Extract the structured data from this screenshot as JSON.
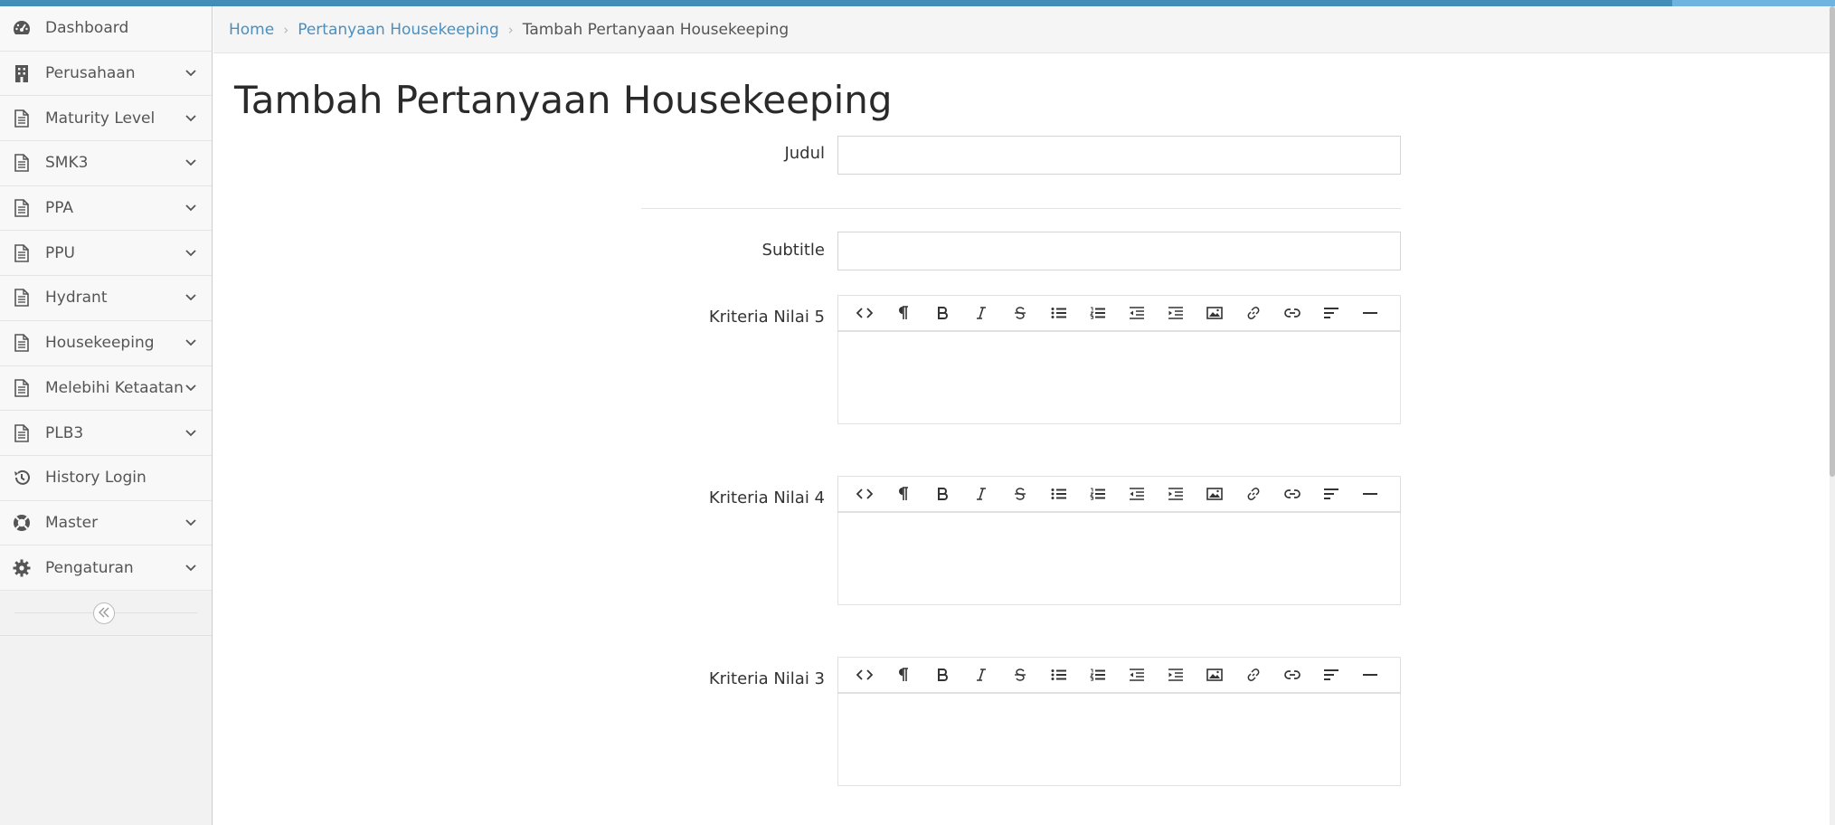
{
  "colors": {
    "topbar": "#438eb9",
    "link": "#4c8fbd",
    "sidebar_bg": "#f2f2f2"
  },
  "sidebar": {
    "items": [
      {
        "label": "Dashboard",
        "icon": "dashboard-icon",
        "has_children": false
      },
      {
        "label": "Perusahaan",
        "icon": "building-icon",
        "has_children": true
      },
      {
        "label": "Maturity Level",
        "icon": "document-icon",
        "has_children": true
      },
      {
        "label": "SMK3",
        "icon": "document-icon",
        "has_children": true
      },
      {
        "label": "PPA",
        "icon": "document-icon",
        "has_children": true
      },
      {
        "label": "PPU",
        "icon": "document-icon",
        "has_children": true
      },
      {
        "label": "Hydrant",
        "icon": "document-icon",
        "has_children": true
      },
      {
        "label": "Housekeeping",
        "icon": "document-icon",
        "has_children": true
      },
      {
        "label": "Melebihi Ketaatan",
        "icon": "document-icon",
        "has_children": true
      },
      {
        "label": "PLB3",
        "icon": "document-icon",
        "has_children": true
      },
      {
        "label": "History Login",
        "icon": "history-icon",
        "has_children": false
      },
      {
        "label": "Master",
        "icon": "lifebuoy-icon",
        "has_children": true
      },
      {
        "label": "Pengaturan",
        "icon": "gear-icon",
        "has_children": true
      }
    ],
    "collapse_icon": "double-chevron-left-icon"
  },
  "breadcrumb": {
    "items": [
      "Home",
      "Pertanyaan Housekeeping"
    ],
    "current": "Tambah Pertanyaan Housekeeping"
  },
  "page": {
    "title": "Tambah Pertanyaan Housekeeping"
  },
  "form": {
    "judul_label": "Judul",
    "judul_value": "",
    "subtitle_label": "Subtitle",
    "subtitle_value": "",
    "editors": [
      {
        "label": "Kriteria Nilai 5",
        "content": ""
      },
      {
        "label": "Kriteria Nilai 4",
        "content": ""
      },
      {
        "label": "Kriteria Nilai 3",
        "content": ""
      }
    ],
    "toolbar_buttons": [
      "code-view-icon",
      "paragraph-icon",
      "bold-icon",
      "italic-icon",
      "strikethrough-icon",
      "unordered-list-icon",
      "ordered-list-icon",
      "outdent-icon",
      "indent-icon",
      "image-icon",
      "link-icon",
      "unlink-icon",
      "align-icon",
      "horizontal-rule-icon"
    ]
  }
}
